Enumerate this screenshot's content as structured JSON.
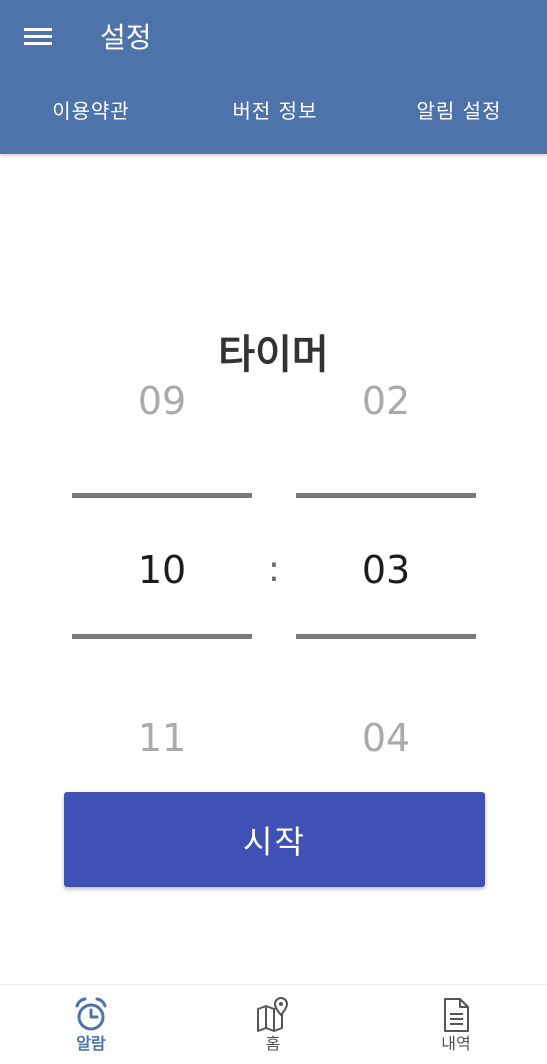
{
  "appbar": {
    "title": "설정",
    "menu_icon": "menu-icon"
  },
  "tabs": [
    {
      "label": "이용약관"
    },
    {
      "label": "버전 정보"
    },
    {
      "label": "알림 설정"
    }
  ],
  "timer": {
    "title": "타이머",
    "hours": {
      "prev": "09",
      "current": "10",
      "next": "11"
    },
    "minutes": {
      "prev": "02",
      "current": "03",
      "next": "04"
    },
    "separator": ":",
    "start_label": "시작"
  },
  "bottom_nav": {
    "items": [
      {
        "label": "알람",
        "icon": "alarm-clock-icon",
        "active": true
      },
      {
        "label": "홈",
        "icon": "map-pin-icon",
        "active": false
      },
      {
        "label": "내역",
        "icon": "document-icon",
        "active": false
      }
    ]
  },
  "colors": {
    "appbar": "#4e73ab",
    "button": "#3f51b5",
    "active_nav": "#4e73ab"
  }
}
